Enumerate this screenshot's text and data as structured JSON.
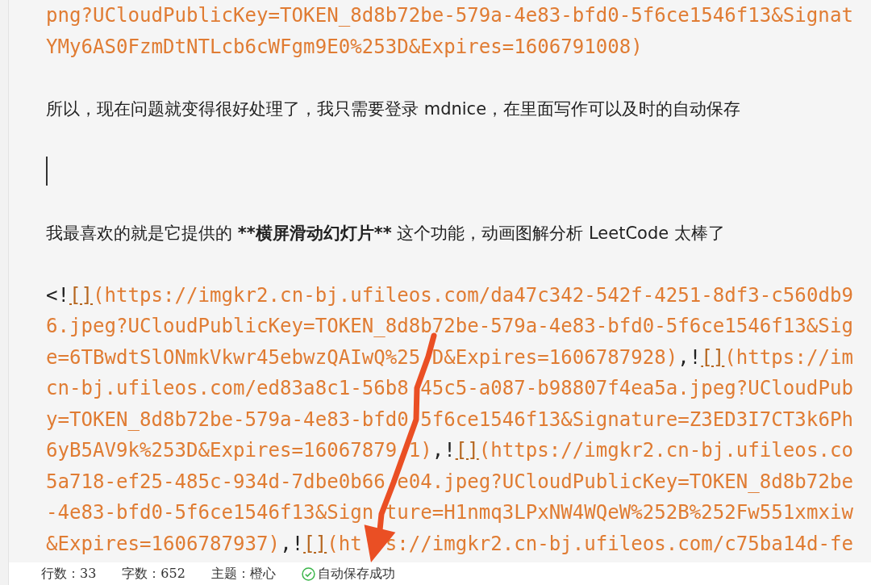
{
  "editor": {
    "lines": [
      {
        "kind": "code",
        "segments": [
          {
            "kind": "url",
            "text": "png?UCloudPublicKey=TOKEN_8d8b72be-579a-4e83-bfd0-5f6ce1546f13&Signat"
          }
        ]
      },
      {
        "kind": "code",
        "segments": [
          {
            "kind": "url",
            "text": "YMy6AS0FzmDtNTLcb6cWFgm9E0%253D&Expires=1606791008)"
          }
        ]
      },
      {
        "kind": "blank"
      },
      {
        "kind": "code",
        "segments": [
          {
            "kind": "text",
            "text": "所以，现在问题就变得很好处理了，我只需要登录 mdnice，在里面写作可以及时的自动保存"
          }
        ]
      },
      {
        "kind": "blank"
      },
      {
        "kind": "cursor"
      },
      {
        "kind": "blank"
      },
      {
        "kind": "code",
        "segments": [
          {
            "kind": "text",
            "text": "我最喜欢的就是它提供的 "
          },
          {
            "kind": "bold",
            "text": "**横屏滑动幻灯片**"
          },
          {
            "kind": "text",
            "text": " 这个功能，动画图解分析 LeetCode 太棒了"
          }
        ]
      },
      {
        "kind": "blank"
      },
      {
        "kind": "code",
        "segments": [
          {
            "kind": "punct",
            "text": "<!"
          },
          {
            "kind": "bracket",
            "text": "[]"
          },
          {
            "kind": "url",
            "text": "(https://imgkr2.cn-bj.ufileos.com/da47c342-542f-4251-8df3-c560db9"
          }
        ]
      },
      {
        "kind": "code",
        "segments": [
          {
            "kind": "url",
            "text": "6.jpeg?UCloudPublicKey=TOKEN_8d8b72be-579a-4e83-bfd0-5f6ce1546f13&Sig"
          }
        ]
      },
      {
        "kind": "code",
        "segments": [
          {
            "kind": "url",
            "text": "e=6TBwdtSlONmkVkwr45ebwzQAIwQ%25"
          },
          {
            "kind": "gap"
          },
          {
            "kind": "url",
            "text": "D&Expires=1606787928)"
          },
          {
            "kind": "punct",
            "text": ",!"
          },
          {
            "kind": "bracket",
            "text": "[]"
          },
          {
            "kind": "url",
            "text": "(https://im"
          }
        ]
      },
      {
        "kind": "code",
        "segments": [
          {
            "kind": "url",
            "text": "cn-bj.ufileos.com/ed83a8c1-56b8"
          },
          {
            "kind": "gap"
          },
          {
            "kind": "url",
            "text": "45c5-a087-b98807f4ea5a.jpeg?UCloudPub"
          }
        ]
      },
      {
        "kind": "code",
        "segments": [
          {
            "kind": "url",
            "text": "y=TOKEN_8d8b72be-579a-4e83-bfd0"
          },
          {
            "kind": "gap"
          },
          {
            "kind": "url",
            "text": "5f6ce1546f13&Signature=Z3ED3I7CT3k6Ph"
          }
        ]
      },
      {
        "kind": "code",
        "segments": [
          {
            "kind": "url",
            "text": "6yB5AV9k%253D&Expires=16067879"
          },
          {
            "kind": "gap"
          },
          {
            "kind": "url",
            "text": "1)"
          },
          {
            "kind": "punct",
            "text": ",!"
          },
          {
            "kind": "bracket",
            "text": "[]"
          },
          {
            "kind": "url",
            "text": "(https://imgkr2.cn-bj.ufileos.co"
          }
        ]
      },
      {
        "kind": "code",
        "segments": [
          {
            "kind": "url",
            "text": "5a718-ef25-485c-934d-7dbe0b66"
          },
          {
            "kind": "gap"
          },
          {
            "kind": "url",
            "text": "e04.jpeg?UCloudPublicKey=TOKEN_8d8b72be"
          }
        ]
      },
      {
        "kind": "code",
        "segments": [
          {
            "kind": "url",
            "text": "-4e83-bfd0-5f6ce1546f13&Sign"
          },
          {
            "kind": "gap"
          },
          {
            "kind": "url",
            "text": "ture=H1nmq3LPxNW4WQeW%252B%252Fw551xmxiw"
          }
        ]
      },
      {
        "kind": "code",
        "segments": [
          {
            "kind": "url",
            "text": "&Expires=1606787937)"
          },
          {
            "kind": "punct",
            "text": ",!"
          },
          {
            "kind": "bracket",
            "text": "[]"
          },
          {
            "kind": "url",
            "text": "(ht"
          },
          {
            "kind": "gap"
          },
          {
            "kind": "gap"
          },
          {
            "kind": "url",
            "text": "s://imgkr2.cn-bj.ufileos.com/c75ba14d-fe"
          }
        ]
      }
    ]
  },
  "status_bar": {
    "items": [
      "行数：33",
      "字数：652",
      "主题：橙心"
    ],
    "save_status": "自动保存成功"
  }
}
